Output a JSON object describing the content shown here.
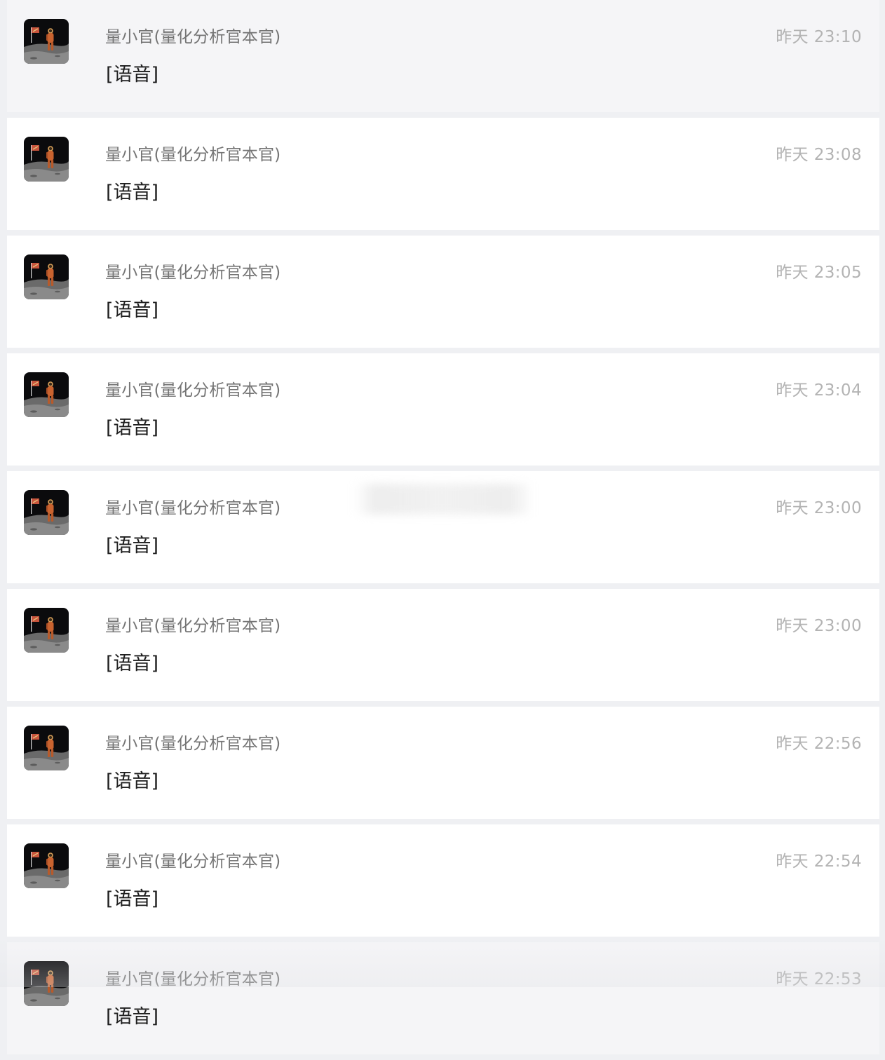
{
  "conversations": [
    {
      "name": "量小官(量化分析官本官)",
      "time": "昨天 23:10",
      "preview": "[语音]",
      "avatar_icon": "astronaut-moon-avatar-icon"
    },
    {
      "name": "量小官(量化分析官本官)",
      "time": "昨天 23:08",
      "preview": "[语音]",
      "avatar_icon": "astronaut-moon-avatar-icon"
    },
    {
      "name": "量小官(量化分析官本官)",
      "time": "昨天 23:05",
      "preview": "[语音]",
      "avatar_icon": "astronaut-moon-avatar-icon"
    },
    {
      "name": "量小官(量化分析官本官)",
      "time": "昨天 23:04",
      "preview": "[语音]",
      "avatar_icon": "astronaut-moon-avatar-icon"
    },
    {
      "name": "量小官(量化分析官本官)",
      "time": "昨天 23:00",
      "preview": "[语音]",
      "avatar_icon": "astronaut-moon-avatar-icon"
    },
    {
      "name": "量小官(量化分析官本官)",
      "time": "昨天 23:00",
      "preview": "[语音]",
      "avatar_icon": "astronaut-moon-avatar-icon"
    },
    {
      "name": "量小官(量化分析官本官)",
      "time": "昨天 22:56",
      "preview": "[语音]",
      "avatar_icon": "astronaut-moon-avatar-icon"
    },
    {
      "name": "量小官(量化分析官本官)",
      "time": "昨天 22:54",
      "preview": "[语音]",
      "avatar_icon": "astronaut-moon-avatar-icon"
    },
    {
      "name": "量小官(量化分析官本官)",
      "time": "昨天 22:53",
      "preview": "[语音]",
      "avatar_icon": "astronaut-moon-avatar-icon"
    }
  ],
  "colors": {
    "page_background": "#eff0f3",
    "item_background": "#ffffff",
    "active_item_background": "#f5f5f7",
    "name_text": "#747474",
    "time_text": "#b3b3b3",
    "preview_text": "#1e1e1e"
  }
}
